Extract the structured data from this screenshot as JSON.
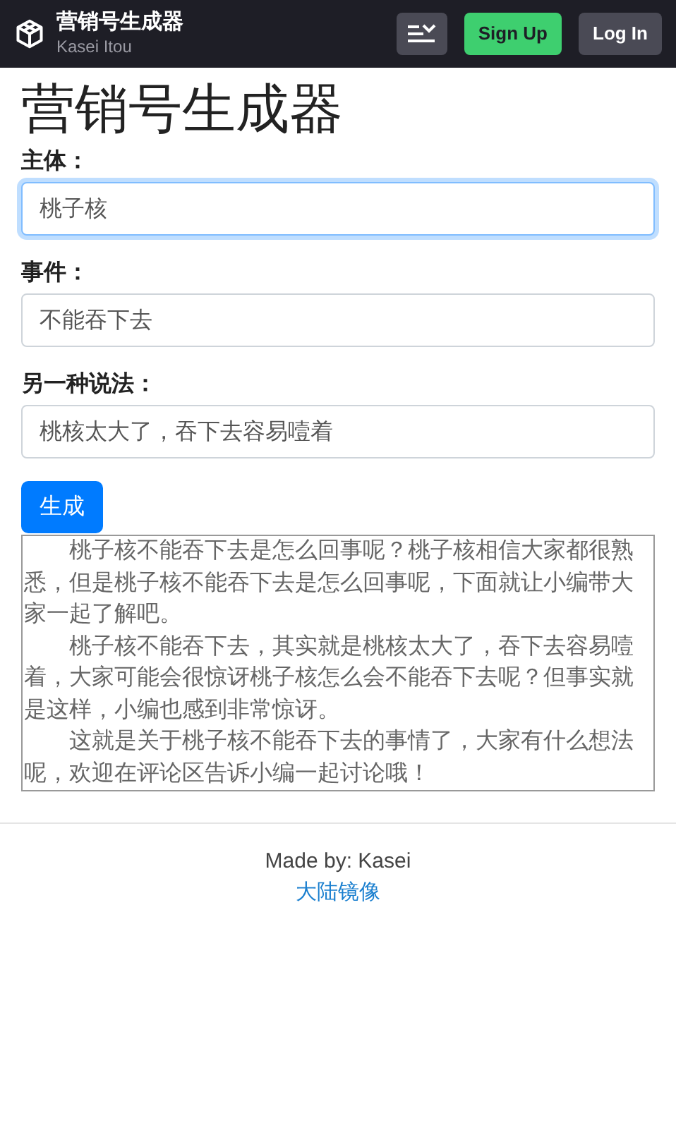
{
  "header": {
    "title": "营销号生成器",
    "subtitle": "Kasei Itou",
    "buttons": [
      {
        "kind": "menu"
      },
      {
        "kind": "signup",
        "label": "Sign Up"
      },
      {
        "kind": "login",
        "label": "Log In"
      }
    ]
  },
  "heading": "营销号生成器",
  "fields": [
    {
      "label": "主体：",
      "value": "桃子核",
      "focused": true
    },
    {
      "label": "事件：",
      "value": "不能吞下去",
      "focused": false
    },
    {
      "label": "另一种说法：",
      "value": "桃核太大了，吞下去容易噎着",
      "focused": false
    }
  ],
  "generate_button": "生成",
  "output": [
    "桃子核不能吞下去是怎么回事呢？桃子核相信大家都很熟悉，但是桃子核不能吞下去是怎么回事呢，下面就让小编带大家一起了解吧。",
    "桃子核不能吞下去，其实就是桃核太大了，吞下去容易噎着，大家可能会很惊讶桃子核怎么会不能吞下去呢？但事实就是这样，小编也感到非常惊讶。",
    "这就是关于桃子核不能吞下去的事情了，大家有什么想法呢，欢迎在评论区告诉小编一起讨论哦！"
  ],
  "footer": {
    "credit": "Made by: Kasei",
    "link": "大陆镜像"
  }
}
